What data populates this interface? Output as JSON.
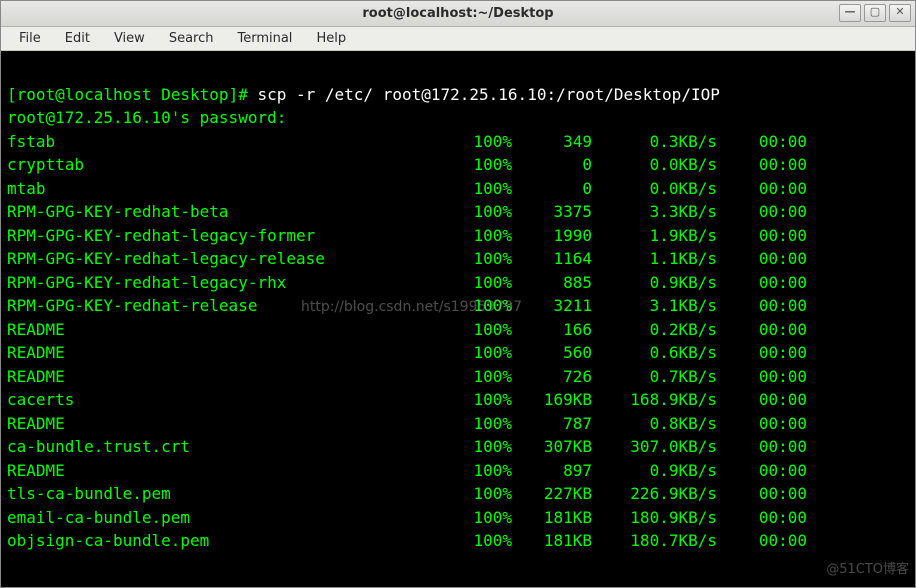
{
  "window": {
    "title": "root@localhost:~/Desktop"
  },
  "menubar": {
    "file": "File",
    "edit": "Edit",
    "view": "View",
    "search": "Search",
    "terminal": "Terminal",
    "help": "Help"
  },
  "prompt": {
    "open": "[",
    "user_host": "root@localhost",
    "space_path": " Desktop",
    "close": "]# ",
    "cmd": "scp -r /etc/ root@172.25.16.10:/root/Desktop/IOP"
  },
  "pw_line": "root@172.25.16.10's password:",
  "rows": [
    {
      "name": "fstab",
      "pct": "100%",
      "size": "349",
      "rate": "0.3KB/s",
      "eta": "00:00"
    },
    {
      "name": "crypttab",
      "pct": "100%",
      "size": "0",
      "rate": "0.0KB/s",
      "eta": "00:00"
    },
    {
      "name": "mtab",
      "pct": "100%",
      "size": "0",
      "rate": "0.0KB/s",
      "eta": "00:00"
    },
    {
      "name": "RPM-GPG-KEY-redhat-beta",
      "pct": "100%",
      "size": "3375",
      "rate": "3.3KB/s",
      "eta": "00:00"
    },
    {
      "name": "RPM-GPG-KEY-redhat-legacy-former",
      "pct": "100%",
      "size": "1990",
      "rate": "1.9KB/s",
      "eta": "00:00"
    },
    {
      "name": "RPM-GPG-KEY-redhat-legacy-release",
      "pct": "100%",
      "size": "1164",
      "rate": "1.1KB/s",
      "eta": "00:00"
    },
    {
      "name": "RPM-GPG-KEY-redhat-legacy-rhx",
      "pct": "100%",
      "size": "885",
      "rate": "0.9KB/s",
      "eta": "00:00"
    },
    {
      "name": "RPM-GPG-KEY-redhat-release",
      "pct": "100%",
      "size": "3211",
      "rate": "3.1KB/s",
      "eta": "00:00"
    },
    {
      "name": "README",
      "pct": "100%",
      "size": "166",
      "rate": "0.2KB/s",
      "eta": "00:00"
    },
    {
      "name": "README",
      "pct": "100%",
      "size": "560",
      "rate": "0.6KB/s",
      "eta": "00:00"
    },
    {
      "name": "README",
      "pct": "100%",
      "size": "726",
      "rate": "0.7KB/s",
      "eta": "00:00"
    },
    {
      "name": "cacerts",
      "pct": "100%",
      "size": "169KB",
      "rate": "168.9KB/s",
      "eta": "00:00"
    },
    {
      "name": "README",
      "pct": "100%",
      "size": "787",
      "rate": "0.8KB/s",
      "eta": "00:00"
    },
    {
      "name": "ca-bundle.trust.crt",
      "pct": "100%",
      "size": "307KB",
      "rate": "307.0KB/s",
      "eta": "00:00"
    },
    {
      "name": "README",
      "pct": "100%",
      "size": "897",
      "rate": "0.9KB/s",
      "eta": "00:00"
    },
    {
      "name": "tls-ca-bundle.pem",
      "pct": "100%",
      "size": "227KB",
      "rate": "226.9KB/s",
      "eta": "00:00"
    },
    {
      "name": "email-ca-bundle.pem",
      "pct": "100%",
      "size": "181KB",
      "rate": "180.9KB/s",
      "eta": "00:00"
    },
    {
      "name": "objsign-ca-bundle.pem",
      "pct": "100%",
      "size": "181KB",
      "rate": "180.7KB/s",
      "eta": "00:00"
    }
  ],
  "watermarks": {
    "center": "http://blog.csdn.net/s19959797",
    "corner": "@51CTO博客"
  }
}
